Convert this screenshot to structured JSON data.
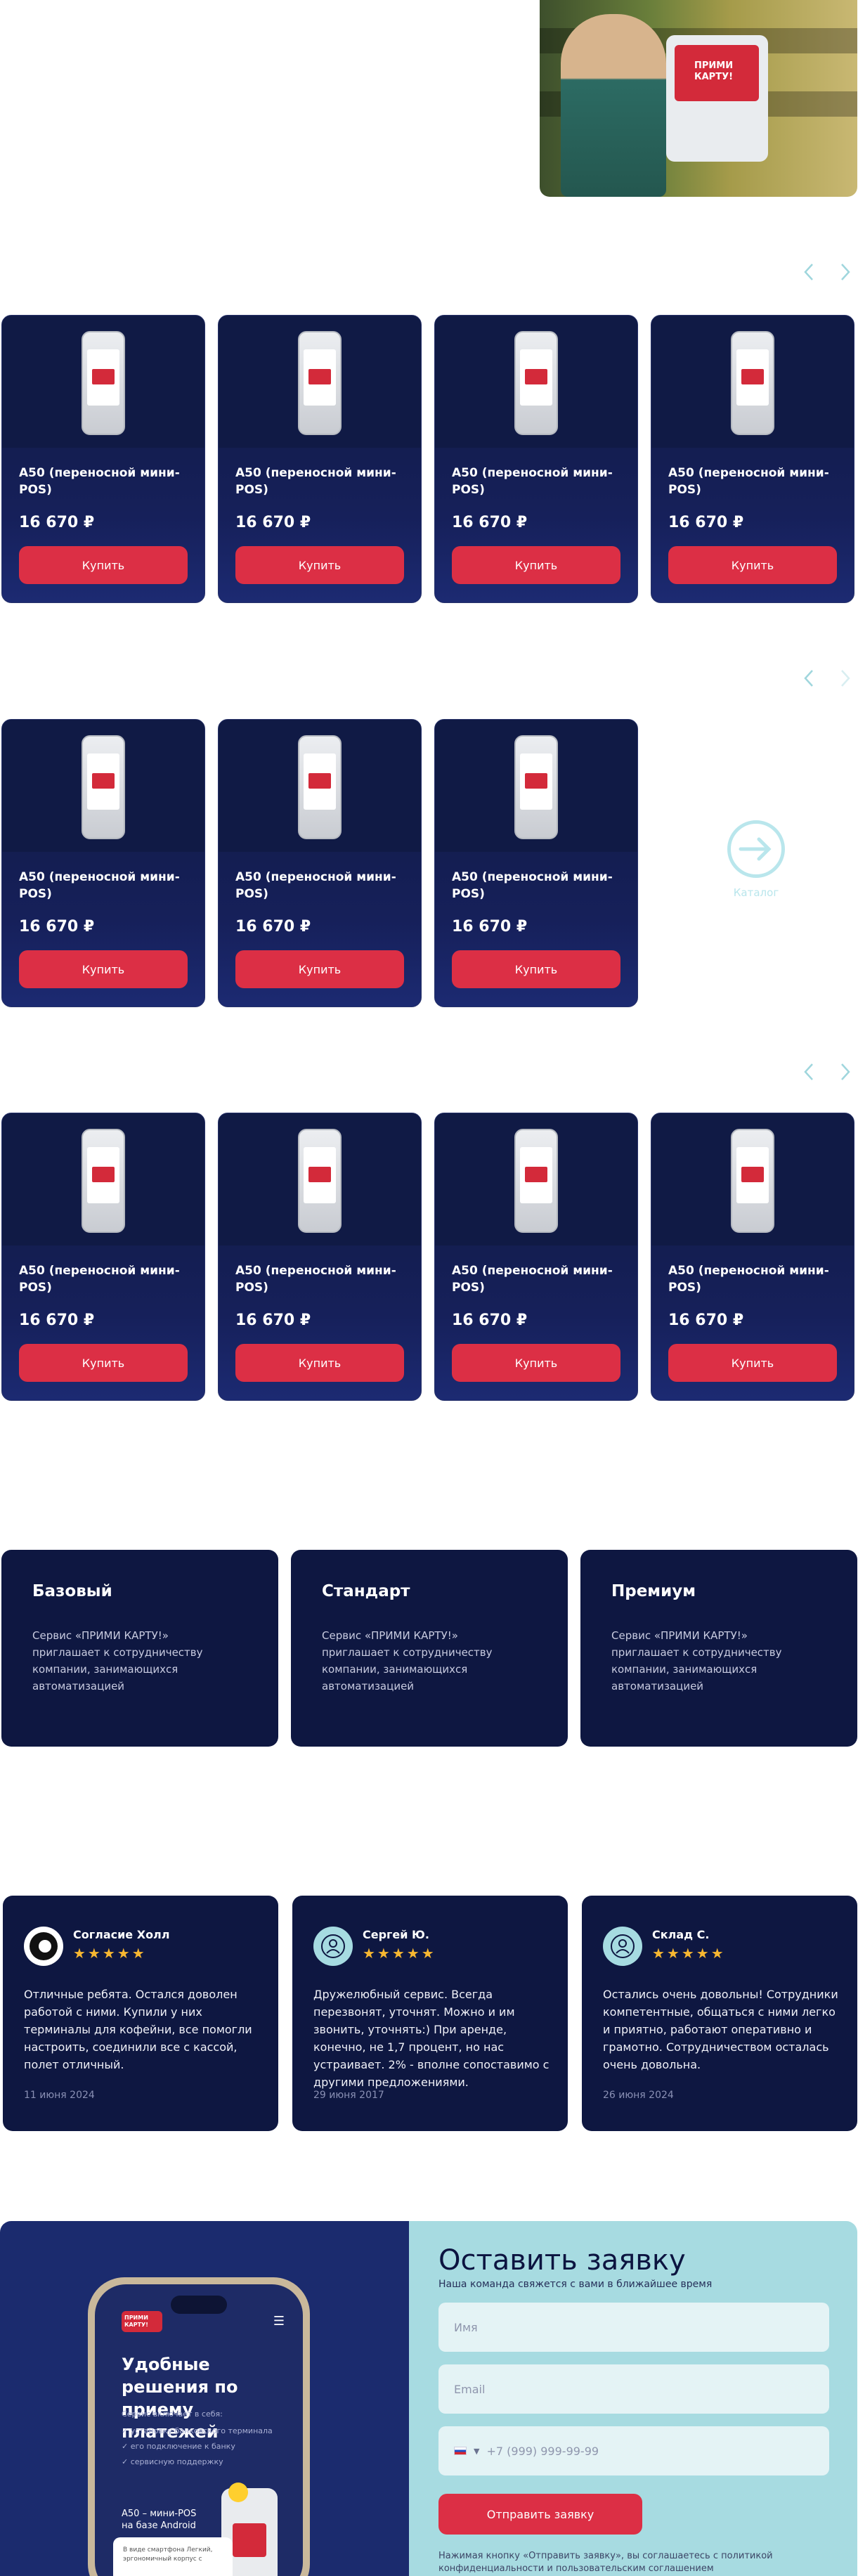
{
  "hero": {
    "terminal_screen_text": "ПРИМИ КАРТУ!"
  },
  "products": {
    "name": "A50 (переносной мини-POS)",
    "price": "16 670 ₽",
    "buy_label": "Купить",
    "logo_text": "ПРИМИ КАРТУ!"
  },
  "catalog_link": {
    "label": "Каталог"
  },
  "plans": [
    {
      "title": "Базовый",
      "text": "Сервис «ПРИМИ КАРТУ!» приглашает к сотрудничеству компании, занимающихся автоматизацией"
    },
    {
      "title": "Стандарт",
      "text": "Сервис «ПРИМИ КАРТУ!» приглашает к сотрудничеству компании, занимающихся автоматизацией"
    },
    {
      "title": "Премиум",
      "text": "Сервис «ПРИМИ КАРТУ!» приглашает к сотрудничеству компании, занимающихся автоматизацией"
    }
  ],
  "reviews": [
    {
      "name": "Согласие Холл",
      "stars": "★★★★★",
      "text": "Отличные ребята. Остался доволен работой с ними. Купили у них терминалы для кофейни, все помогли настроить, соединили все с кассой, полет отличный.",
      "date": "11 июня 2024"
    },
    {
      "name": "Сергей Ю.",
      "stars": "★★★★★",
      "text": "Дружелюбный сервис. Всегда перезвонят, уточнят. Можно и им звонить, уточнять:) При аренде, конечно, не 1,7 процент, но нас устраивает. 2% - вполне сопоставимо с другими предложениями.",
      "date": "29 июня 2017"
    },
    {
      "name": "Склад С.",
      "stars": "★★★★★",
      "text": "Остались очень довольны! Сотрудники компетентные, общаться с ними легко и приятно, работают оперативно и грамотно. Сотрудничеством осталась очень довольна.",
      "date": "26 июня 2024"
    }
  ],
  "phone_mock": {
    "logo": "ПРИМИ КАРТУ!",
    "headline": "Удобные решения по приему платежей",
    "sub": "Сервис включает в себя:",
    "items": [
      "✓ установку банковского терминала",
      "✓ его подключение к банку",
      "✓ сервисную поддержку"
    ],
    "product": "A50 – мини-POS на базе Android",
    "card_text": "В виде смартфона Легкий, эргономичный корпус с"
  },
  "form": {
    "title": "Оставить заявку",
    "lead": "Наша команда свяжется с вами в ближайшее время",
    "name_placeholder": "Имя",
    "email_placeholder": "Email",
    "phone_placeholder": "+7 (999) 999-99-99",
    "submit_label": "Отправить заявку",
    "consent": "Нажимая кнопку «Отправить заявку», вы соглашаетесь с политикой конфиденциальности и пользовательским соглашением"
  },
  "colors": {
    "accent": "#dc2f45",
    "dark": "#0e1741",
    "light_teal": "#a7dbe1"
  }
}
